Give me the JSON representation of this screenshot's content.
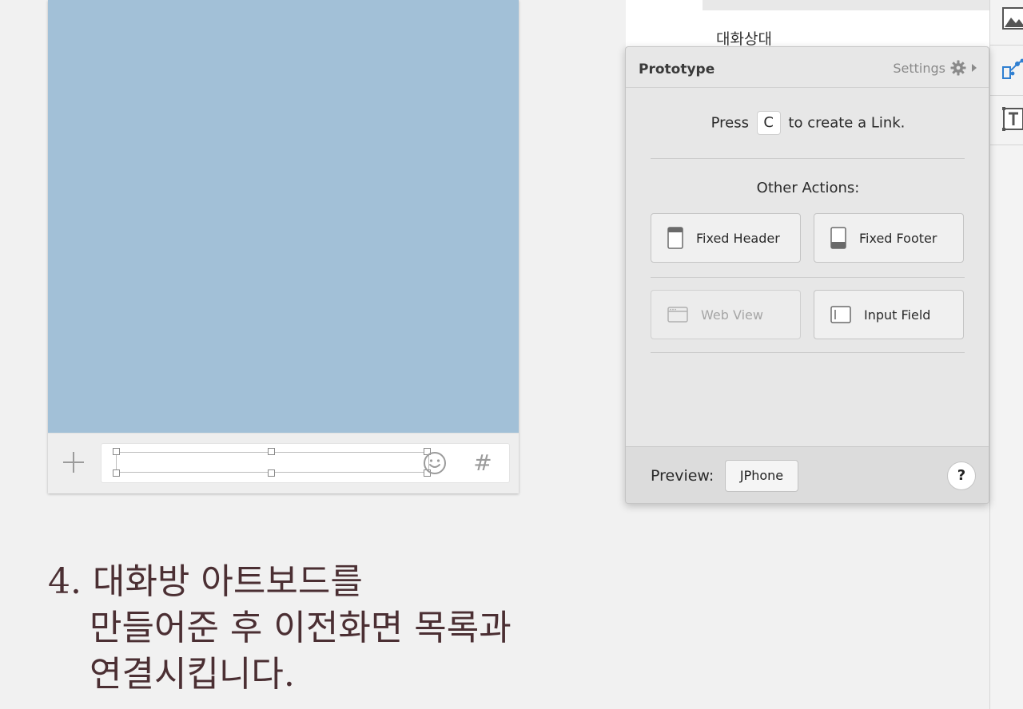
{
  "layers": {
    "label": "대화상대"
  },
  "prototype": {
    "title": "Prototype",
    "settings_label": "Settings",
    "press_prefix": "Press",
    "press_key": "C",
    "press_suffix": "to create a Link.",
    "other_actions_title": "Other Actions:",
    "actions": [
      {
        "label": "Fixed Header",
        "icon": "fixed-header-icon",
        "enabled": true
      },
      {
        "label": "Fixed Footer",
        "icon": "fixed-footer-icon",
        "enabled": true
      },
      {
        "label": "Web View",
        "icon": "web-view-icon",
        "enabled": false
      },
      {
        "label": "Input Field",
        "icon": "input-field-icon",
        "enabled": true
      }
    ],
    "preview_label": "Preview:",
    "preview_device": "JPhone",
    "help_label": "?"
  },
  "composer": {
    "plus_icon": "plus-icon",
    "smile_icon": "smile-icon",
    "hash_label": "#"
  },
  "caption": {
    "line1": "4. 대화방 아트보드를",
    "line2": "만들어준 후 이전화면 목록과",
    "line3": "연결시킵니다."
  },
  "colors": {
    "artboard_fill": "#a2c0d7",
    "caption_text": "#4b2f33",
    "accent_blue": "#2f7fd1"
  }
}
